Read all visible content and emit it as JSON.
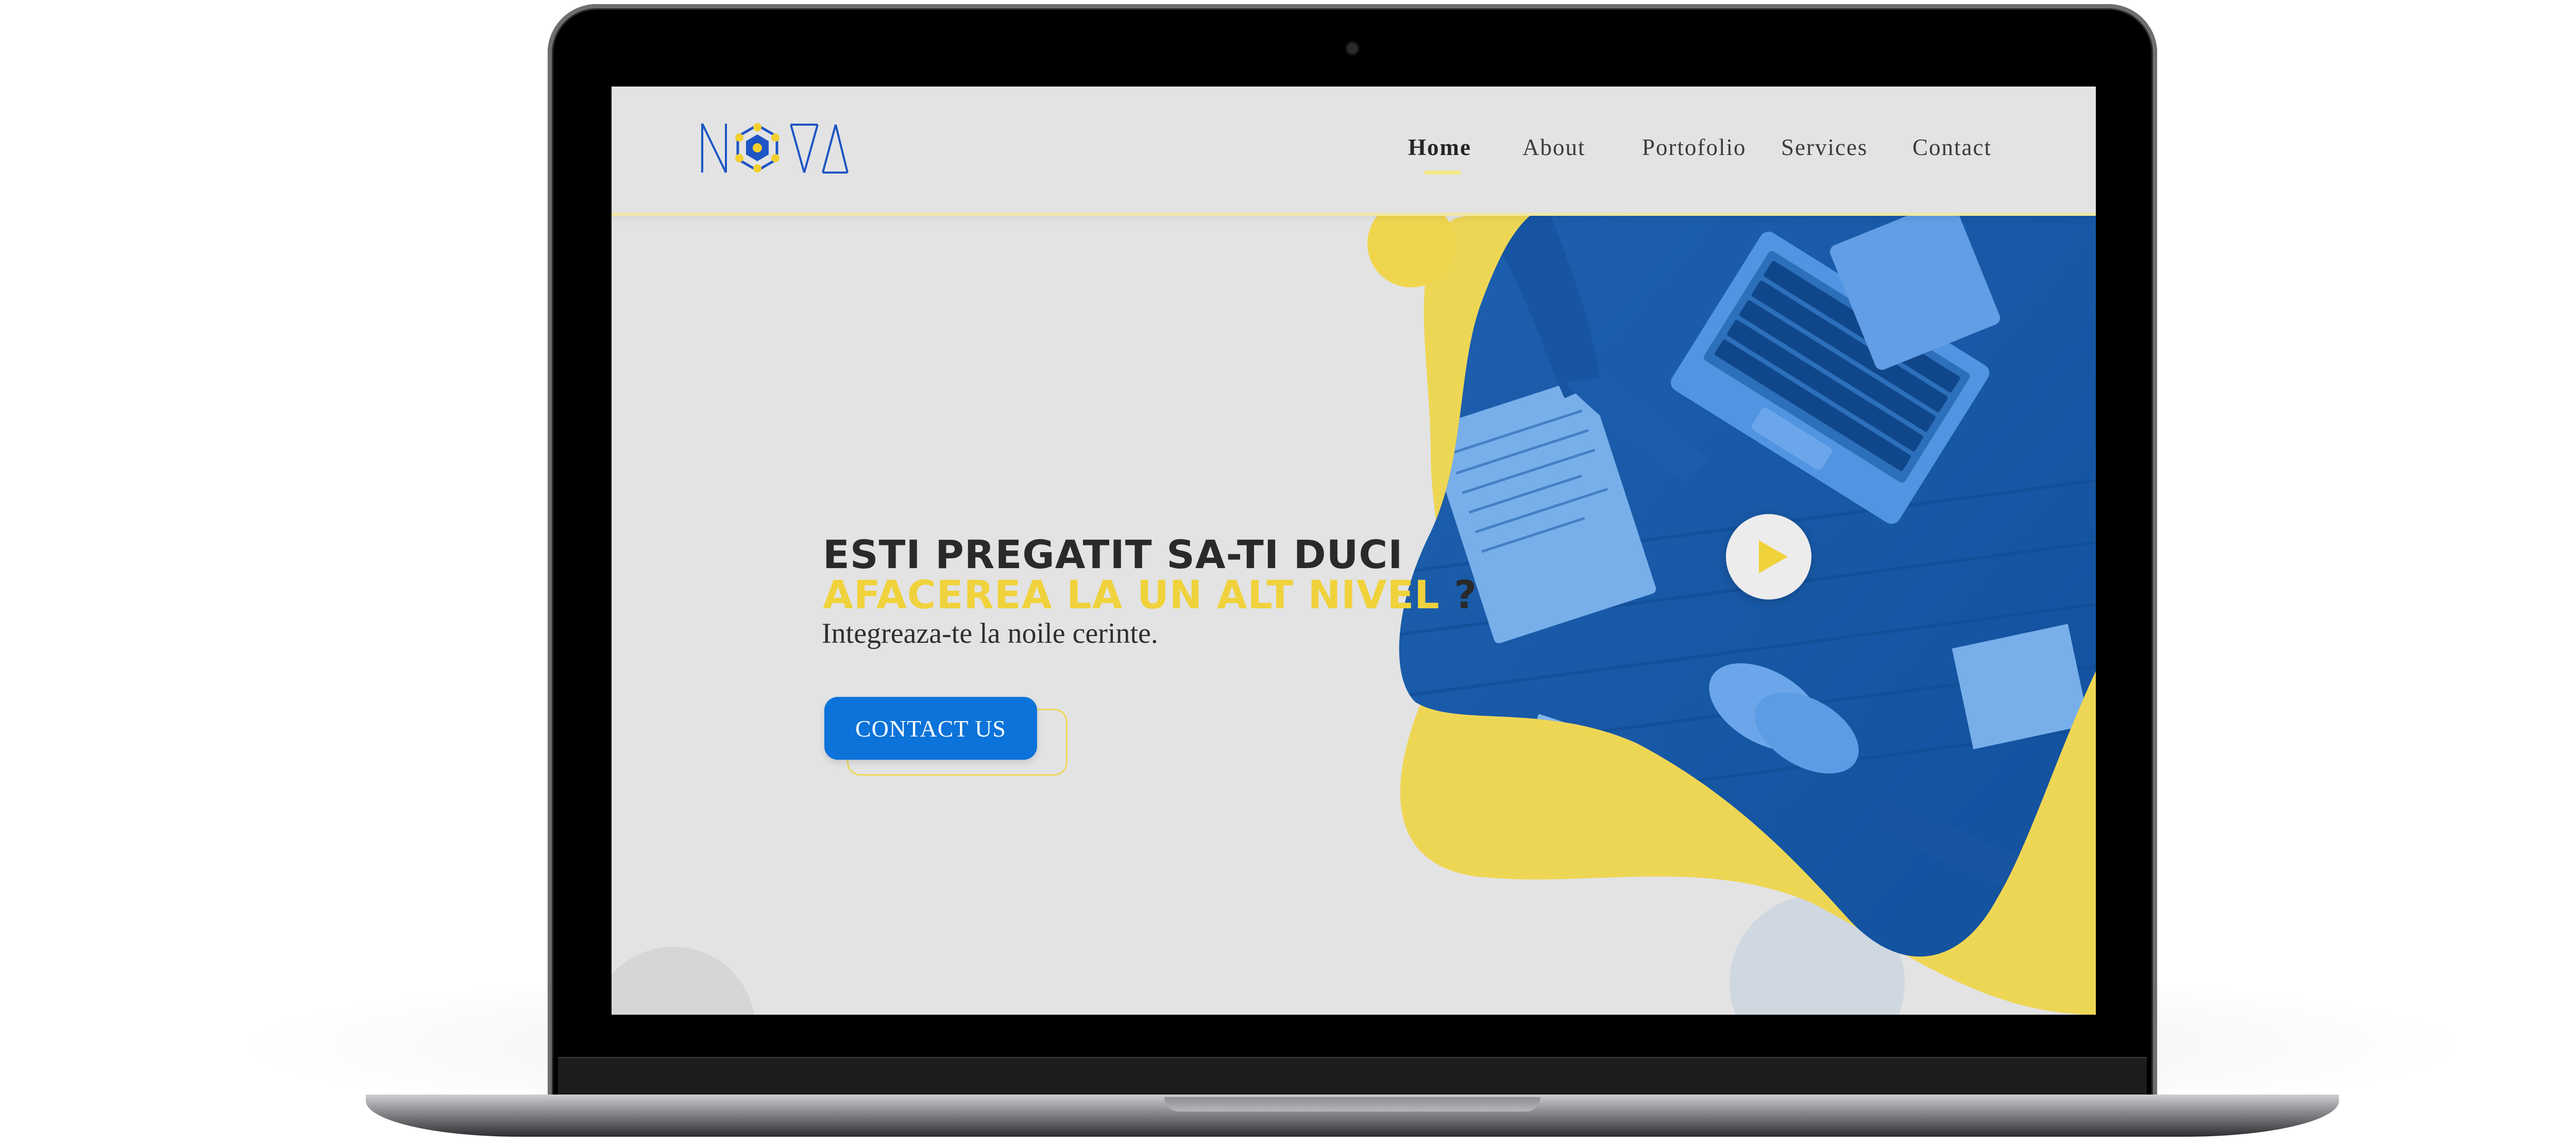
{
  "brand": {
    "logo_text": "NOVA",
    "colors": {
      "yellow": "#f0d23c",
      "blue": "#0b73d9",
      "dark": "#2a2a2a",
      "background": "#e3e3e4"
    }
  },
  "nav": {
    "items": [
      {
        "label": "Home",
        "active": true
      },
      {
        "label": "About",
        "active": false
      },
      {
        "label": "Portofolio",
        "active": false
      },
      {
        "label": "Services",
        "active": false
      },
      {
        "label": "Contact",
        "active": false
      }
    ]
  },
  "hero": {
    "heading_line1": "ESTI PREGATIT SA-TI DUCI",
    "heading_line2_accent": "AFACEREA LA UN ALT NIVEL",
    "heading_line2_suffix": " ?",
    "subtitle": "Integreaza-te la noile cerinte.",
    "cta_label": "CONTACT US",
    "play_icon": "play-icon",
    "image_description_icon": "handshake-image"
  }
}
